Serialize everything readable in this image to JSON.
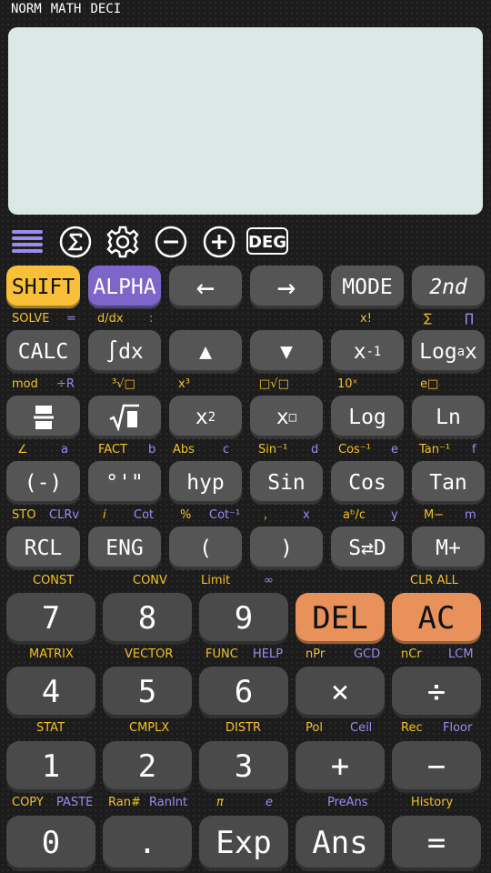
{
  "status": {
    "mode1": "NORM",
    "mode2": "MATH",
    "mode3": "DECI"
  },
  "toolbar": {
    "deg": "DEG"
  },
  "row1": {
    "shift": "SHIFT",
    "alpha": "ALPHA",
    "left": "←",
    "right": "→",
    "mode": "MODE",
    "second": "2nd"
  },
  "row1_labels": {
    "solve": "SOLVE",
    "eq": "=",
    "ddx": "d/dx",
    "colon": ":",
    "fact": "x!",
    "sum": "∑",
    "prod": "∏"
  },
  "row2": {
    "calc": "CALC",
    "integral": "∫dx",
    "up": "▲",
    "down": "▼",
    "inv_base": "x",
    "inv_exp": "-1",
    "log_a": "Log",
    "log_sub": "a",
    "log_x": "x"
  },
  "row2_labels": {
    "mod": "mod",
    "divr": "÷R",
    "cbrt": "³√□",
    "cube": "x³",
    "nthroot": "□√□",
    "tenx": "10ˣ",
    "ex": "e□"
  },
  "row3": {
    "frac": "frac",
    "sqrt": "√□",
    "sq_base": "x",
    "sq_exp": "2",
    "pow_base": "x",
    "pow_exp": "□",
    "log": "Log",
    "ln": "Ln"
  },
  "row3_labels": {
    "angle": "∠",
    "a": "a",
    "fact": "FACT",
    "b": "b",
    "abs": "Abs",
    "c": "c",
    "asin": "Sin⁻¹",
    "d": "d",
    "acos": "Cos⁻¹",
    "e": "e",
    "atan": "Tan⁻¹",
    "f": "f"
  },
  "row4": {
    "neg": "(-)",
    "dms": "°'\"",
    "hyp": "hyp",
    "sin": "Sin",
    "cos": "Cos",
    "tan": "Tan"
  },
  "row4_labels": {
    "sto": "STO",
    "clrv": "CLRv",
    "i": "i",
    "cot": "Cot",
    "pct": "%",
    "acot": "Cot⁻¹",
    "comma": ",",
    "x": "x",
    "abc": "aᵇ/c",
    "y": "y",
    "mminus": "M−",
    "m": "m"
  },
  "row5": {
    "rcl": "RCL",
    "eng": "ENG",
    "lparen": "(",
    "rparen": ")",
    "sd": "S⇄D",
    "mplus": "M+"
  },
  "row5_labels": {
    "const": "CONST",
    "conv": "CONV",
    "limit": "Limit",
    "inf": "∞",
    "clrall": "CLR ALL"
  },
  "row6": {
    "k7": "7",
    "k8": "8",
    "k9": "9",
    "del": "DEL",
    "ac": "AC"
  },
  "row6_labels": {
    "matrix": "MATRIX",
    "vector": "VECTOR",
    "func": "FUNC",
    "help": "HELP",
    "npr": "nPr",
    "gcd": "GCD",
    "ncr": "nCr",
    "lcm": "LCM"
  },
  "row7": {
    "k4": "4",
    "k5": "5",
    "k6": "6",
    "mul": "×",
    "div": "÷"
  },
  "row7_labels": {
    "stat": "STAT",
    "cmplx": "CMPLX",
    "distr": "DISTR",
    "pol": "Pol",
    "ceil": "Ceil",
    "rec": "Rec",
    "floor": "Floor"
  },
  "row8": {
    "k1": "1",
    "k2": "2",
    "k3": "3",
    "add": "+",
    "sub": "−"
  },
  "row8_labels": {
    "copy": "COPY",
    "paste": "PASTE",
    "ran": "Ran#",
    "ranint": "RanInt",
    "pi": "π",
    "e": "e",
    "preans": "PreAns",
    "history": "History"
  },
  "row9": {
    "k0": "0",
    "dot": ".",
    "exp": "Exp",
    "ans": "Ans",
    "eq": "="
  }
}
